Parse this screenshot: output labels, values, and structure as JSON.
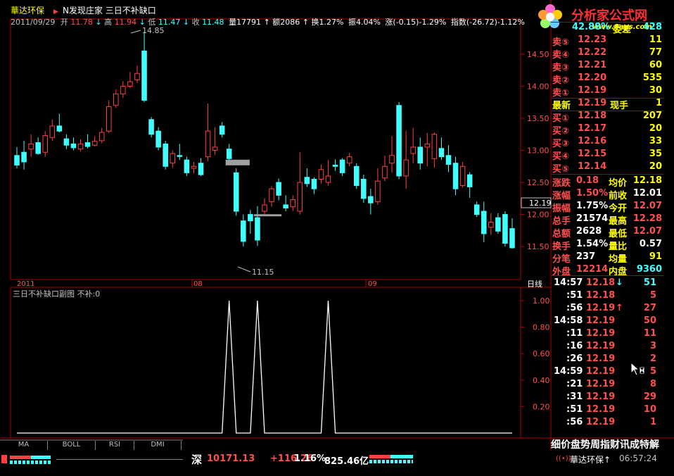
{
  "header": {
    "stock_name": "華达环保",
    "title_arrow": "▶",
    "pattern_label": "N发现庄家  三日不补缺口",
    "info_date": "2011/09/29",
    "info_open_label": "开",
    "info_open": "11.78",
    "info_high_label": "高",
    "info_high": "11.94",
    "info_low_label": "低",
    "info_low": "11.47",
    "info_close_label": "收",
    "info_close": "11.48",
    "info_vol": "量17791",
    "info_amount": "额2086",
    "info_turnover": "换1.27%",
    "info_amplitude": "振4.04%",
    "info_change": "涨(-0.15)-1.29%",
    "info_index": "指数(-26.72)-1.12%"
  },
  "watermark": {
    "text": "分析家公式网",
    "url": "www.8ags.com"
  },
  "top_right": {
    "weibi_pct": "42.88%",
    "weicha_label": "委差",
    "weicha_value": "428"
  },
  "price_axis": {
    "labels": [
      "14.50",
      "14.00",
      "13.50",
      "13.00",
      "12.50",
      "12.00",
      "11.50"
    ],
    "current": "12.19",
    "high_marker": "14.85",
    "low_marker": "11.15"
  },
  "date_axis": {
    "labels": [
      "2011",
      "08",
      "09"
    ],
    "period": "日线"
  },
  "indicator": {
    "title": "三日不补缺口副图  不补:0",
    "labels": [
      "1.00",
      "0.80",
      "0.60",
      "0.40",
      "0.20"
    ]
  },
  "order_book": {
    "sells": [
      {
        "label": "卖⑤",
        "price": "12.23",
        "vol": "11"
      },
      {
        "label": "卖④",
        "price": "12.22",
        "vol": "77"
      },
      {
        "label": "卖③",
        "price": "12.21",
        "vol": "60"
      },
      {
        "label": "卖②",
        "price": "12.20",
        "vol": "535"
      },
      {
        "label": "卖①",
        "price": "12.19",
        "vol": "30"
      }
    ],
    "latest": {
      "label": "最新",
      "price": "12.19",
      "hand_label": "现手",
      "hand": "1"
    },
    "buys": [
      {
        "label": "买①",
        "price": "12.18",
        "vol": "207"
      },
      {
        "label": "买②",
        "price": "12.17",
        "vol": "20"
      },
      {
        "label": "买③",
        "price": "12.16",
        "vol": "33"
      },
      {
        "label": "买④",
        "price": "12.15",
        "vol": "35"
      },
      {
        "label": "买⑤",
        "price": "12.14",
        "vol": "20"
      }
    ]
  },
  "stats": [
    {
      "l1": "涨跌",
      "v1": "0.18",
      "l2": "均价",
      "v2": "12.18"
    },
    {
      "l1": "涨幅",
      "v1": "1.50%",
      "l2": "前收",
      "v2": "12.01"
    },
    {
      "l1": "振幅",
      "v1": "1.75%",
      "l2": "今开",
      "v2": "12.07"
    },
    {
      "l1": "总手",
      "v1": "21574",
      "l2": "最高",
      "v2": "12.28"
    },
    {
      "l1": "总额",
      "v1": "2628",
      "l2": "最低",
      "v2": "12.07"
    },
    {
      "l1": "换手",
      "v1": "1.54%",
      "l2": "量比",
      "v2": "0.57"
    },
    {
      "l1": "分笔",
      "v1": "237",
      "l2": "均量",
      "v2": "91"
    },
    {
      "l1": "外盘",
      "v1": "12214",
      "l2": "内盘",
      "v2": "9360"
    }
  ],
  "ticks": [
    {
      "time": "14:57",
      "price": "12.18",
      "arrow": "↓",
      "vol": "51"
    },
    {
      "time": ":51",
      "price": "12.18",
      "arrow": "",
      "vol": "5"
    },
    {
      "time": ":56",
      "price": "12.19",
      "arrow": "↑",
      "vol": "27"
    },
    {
      "time": "14:58",
      "price": "12.19",
      "arrow": "",
      "vol": "50"
    },
    {
      "time": ":11",
      "price": "12.19",
      "arrow": "",
      "vol": "11"
    },
    {
      "time": ":16",
      "price": "12.19",
      "arrow": "",
      "vol": "3"
    },
    {
      "time": ":26",
      "price": "12.19",
      "arrow": "",
      "vol": "2"
    },
    {
      "time": "14:59",
      "price": "12.19",
      "arrow": "",
      "vol": "5"
    },
    {
      "time": ":21",
      "price": "12.19",
      "arrow": "",
      "vol": "8"
    },
    {
      "time": ":31",
      "price": "12.19",
      "arrow": "",
      "vol": "29"
    },
    {
      "time": ":51",
      "price": "12.19",
      "arrow": "",
      "vol": "10"
    },
    {
      "time": ":56",
      "price": "12.19",
      "arrow": "",
      "vol": "1"
    }
  ],
  "bottom_tabs": {
    "right_tabs": "细价盘势周指财讯成特解",
    "left_tabs": [
      "MA",
      "BOLL",
      "RSI",
      "DMI"
    ]
  },
  "statusbar": {
    "market": "深",
    "index_value": "10171.13",
    "index_change": "+116.26",
    "index_pct": "1.16%",
    "amount": "825.46亿",
    "stock": "華达环保↑",
    "clock": "06:57:24"
  },
  "colors": {
    "up": "#ff4040",
    "down": "#40ffff",
    "frame": "#b00000",
    "yellow": "#ffff00",
    "white": "#ffffff",
    "axis_text": "#ff5050",
    "gray": "#c0c0c0"
  },
  "chart_data": [
    {
      "type": "candlestick",
      "title": "",
      "ylim": [
        11.15,
        14.85
      ],
      "ohlc": [
        [
          12.92,
          12.77,
          13.05,
          12.72
        ],
        [
          12.97,
          12.82,
          13.15,
          12.7
        ],
        [
          13.02,
          13.1,
          13.25,
          12.9
        ],
        [
          13.12,
          12.95,
          13.2,
          12.93
        ],
        [
          12.97,
          13.23,
          13.3,
          12.9
        ],
        [
          13.2,
          13.38,
          13.48,
          13.15
        ],
        [
          13.38,
          13.3,
          13.57,
          13.28
        ],
        [
          13.18,
          13.08,
          13.25,
          13.02
        ],
        [
          13.1,
          13.04,
          13.2,
          13.0
        ],
        [
          13.02,
          13.1,
          13.17,
          12.98
        ],
        [
          13.12,
          13.06,
          13.25,
          13.03
        ],
        [
          13.08,
          13.14,
          13.22,
          13.06
        ],
        [
          13.15,
          13.28,
          13.35,
          13.11
        ],
        [
          13.3,
          13.68,
          13.78,
          13.27
        ],
        [
          13.7,
          13.88,
          13.95,
          13.66
        ],
        [
          13.88,
          14.0,
          14.08,
          13.82
        ],
        [
          14.0,
          14.07,
          14.22,
          13.97
        ],
        [
          14.1,
          14.2,
          14.32,
          14.05
        ],
        [
          14.55,
          13.78,
          14.85,
          13.75
        ],
        [
          13.48,
          13.25,
          13.52,
          13.2
        ],
        [
          13.3,
          13.05,
          13.36,
          13.0
        ],
        [
          13.1,
          12.75,
          13.15,
          12.7
        ],
        [
          12.8,
          12.95,
          13.0,
          12.73
        ],
        [
          12.92,
          12.91,
          13.1,
          12.85
        ],
        [
          12.85,
          12.65,
          12.9,
          12.6
        ],
        [
          12.72,
          12.75,
          12.82,
          12.64
        ],
        [
          12.8,
          12.62,
          12.88,
          12.6
        ],
        [
          12.9,
          13.3,
          13.73,
          12.83
        ],
        [
          13.0,
          13.05,
          13.36,
          12.93
        ],
        [
          13.38,
          13.25,
          13.44,
          13.2
        ],
        [
          13.02,
          12.87,
          13.1,
          12.8
        ],
        [
          12.65,
          12.05,
          12.72,
          11.98
        ],
        [
          11.9,
          11.58,
          12.0,
          11.5
        ],
        [
          12.0,
          11.9,
          12.07,
          11.7
        ],
        [
          11.95,
          11.6,
          12.13,
          11.51
        ],
        [
          12.05,
          12.15,
          12.25,
          12.0
        ],
        [
          12.2,
          12.4,
          12.44,
          12.12
        ],
        [
          12.5,
          12.3,
          12.56,
          12.22
        ],
        [
          12.15,
          12.1,
          12.3,
          12.05
        ],
        [
          12.12,
          12.23,
          12.3,
          12.05
        ],
        [
          12.05,
          12.5,
          12.97,
          12.0
        ],
        [
          12.58,
          12.48,
          12.72,
          12.43
        ],
        [
          12.55,
          12.4,
          12.58,
          12.32
        ],
        [
          12.55,
          12.7,
          12.78,
          12.48
        ],
        [
          12.5,
          12.6,
          12.85,
          12.45
        ],
        [
          12.77,
          12.75,
          12.86,
          12.68
        ],
        [
          12.85,
          12.65,
          12.88,
          12.6
        ],
        [
          12.8,
          12.9,
          12.96,
          12.75
        ],
        [
          12.75,
          12.45,
          12.8,
          12.4
        ],
        [
          12.55,
          12.25,
          12.62,
          12.18
        ],
        [
          12.28,
          12.18,
          12.4,
          12.0
        ],
        [
          12.2,
          12.52,
          12.72,
          12.15
        ],
        [
          12.57,
          12.75,
          12.92,
          12.52
        ],
        [
          12.8,
          12.92,
          13.22,
          12.65
        ],
        [
          13.7,
          12.6,
          13.75,
          12.55
        ],
        [
          12.6,
          12.85,
          13.3,
          12.4
        ],
        [
          12.95,
          13.05,
          13.35,
          12.8
        ],
        [
          13.05,
          12.8,
          13.2,
          12.7
        ],
        [
          13.05,
          13.1,
          13.27,
          12.75
        ],
        [
          12.87,
          13.25,
          13.28,
          12.73
        ],
        [
          13.03,
          12.9,
          13.2,
          12.85
        ],
        [
          12.92,
          12.78,
          13.08,
          12.66
        ],
        [
          12.8,
          12.4,
          12.9,
          12.3
        ],
        [
          12.45,
          12.75,
          12.82,
          12.42
        ],
        [
          12.62,
          12.43,
          12.66,
          12.26
        ],
        [
          12.15,
          12.0,
          12.2,
          11.96
        ],
        [
          12.05,
          11.7,
          12.2,
          11.57
        ],
        [
          11.8,
          11.88,
          12.02,
          11.68
        ],
        [
          11.95,
          11.74,
          12.02,
          11.7
        ],
        [
          12.0,
          11.55,
          12.05,
          11.5
        ],
        [
          11.78,
          11.48,
          11.94,
          11.47
        ]
      ],
      "gaps": [
        {
          "start_index": 30,
          "price": 12.81
        },
        {
          "start_index": 34,
          "price": 11.96
        }
      ]
    },
    {
      "type": "line",
      "title": "",
      "ylim": [
        0,
        1.1
      ],
      "values": [
        0,
        0,
        0,
        0,
        0,
        0,
        0,
        0,
        0,
        0,
        0,
        0,
        0,
        0,
        0,
        0,
        0,
        0,
        0,
        0,
        0,
        0,
        0,
        0,
        0,
        0,
        0,
        0,
        0,
        0,
        1,
        0,
        0,
        0,
        1,
        0,
        0,
        0,
        0,
        0,
        0,
        0,
        0,
        0,
        1,
        0,
        0,
        0,
        0,
        0,
        0,
        0,
        0,
        0,
        0,
        0,
        0,
        0,
        0,
        0,
        0,
        0,
        0,
        0,
        0,
        0,
        0,
        0,
        0,
        0,
        0
      ]
    }
  ]
}
